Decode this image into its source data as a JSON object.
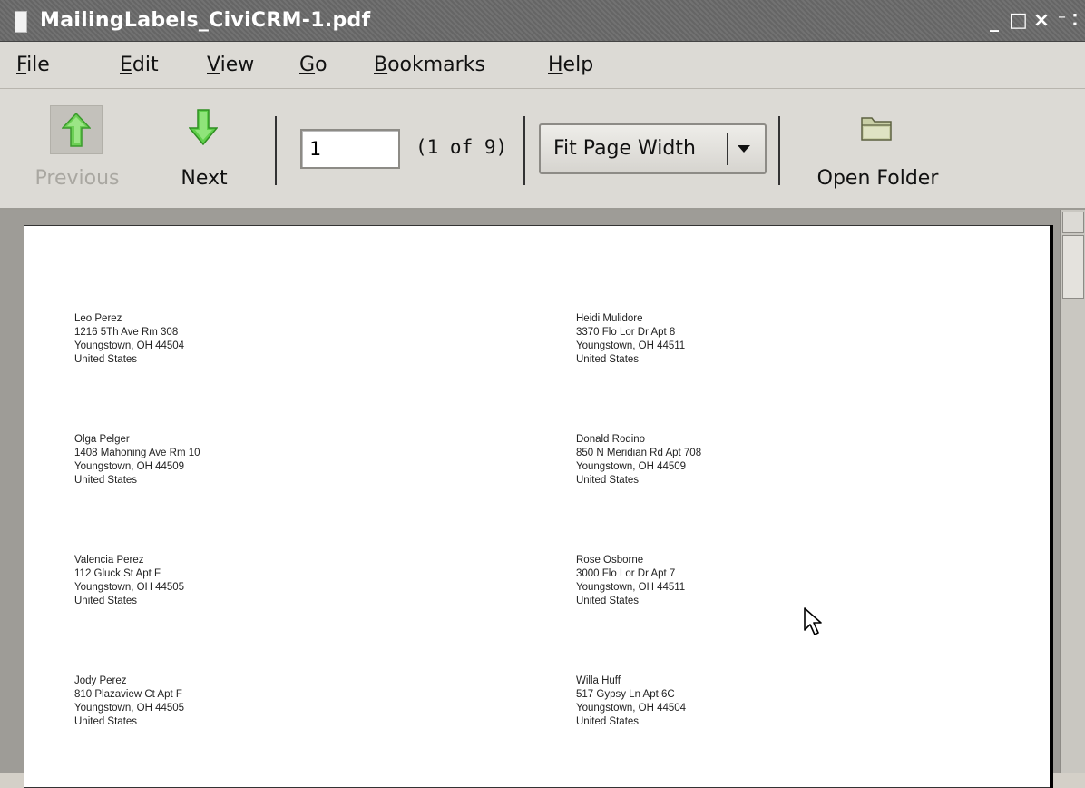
{
  "window": {
    "title": "MailingLabels_CiviCRM-1.pdf",
    "controls": {
      "minimize": "_",
      "maximize": "□",
      "close": "×",
      "extra": "⁻ ⁚"
    }
  },
  "menu": [
    {
      "label": "File",
      "mnemonic": "F",
      "rest": "ile"
    },
    {
      "label": "Edit",
      "mnemonic": "E",
      "rest": "dit"
    },
    {
      "label": "View",
      "mnemonic": "V",
      "rest": "iew"
    },
    {
      "label": "Go",
      "mnemonic": "G",
      "rest": "o"
    },
    {
      "label": "Bookmarks",
      "mnemonic": "B",
      "rest": "ookmarks"
    },
    {
      "label": "Help",
      "mnemonic": "H",
      "rest": "elp"
    }
  ],
  "toolbar": {
    "previous_label": "Previous",
    "previous_enabled": false,
    "next_label": "Next",
    "page_value": "1",
    "page_count": "(1 of 9)",
    "zoom_value": "Fit Page Width",
    "open_folder_label": "Open Folder",
    "icons": {
      "previous": "up-arrow-icon",
      "next": "down-arrow-icon",
      "zoom_dropdown": "dropdown-arrow-icon",
      "open_folder": "folder-icon"
    },
    "colors": {
      "arrow_green": "#5fcf4a",
      "arrow_green_dark": "#2f8f22",
      "disabled_text": "#a9a7a1"
    }
  },
  "labels": {
    "left": [
      [
        "Leo Perez",
        "1216 5Th Ave Rm 308",
        "Youngstown, OH 44504",
        "United States"
      ],
      [
        "Olga Pelger",
        "1408 Mahoning Ave Rm 10",
        "Youngstown, OH 44509",
        "United States"
      ],
      [
        "Valencia Perez",
        "112 Gluck St Apt F",
        "Youngstown, OH 44505",
        "United States"
      ],
      [
        "Jody Perez",
        "810 Plazaview Ct Apt F",
        "Youngstown, OH 44505",
        "United States"
      ]
    ],
    "right": [
      [
        "Heidi Mulidore",
        "3370 Flo Lor Dr Apt 8",
        "Youngstown, OH 44511",
        "United States"
      ],
      [
        "Donald Rodino",
        "850 N Meridian Rd Apt 708",
        "Youngstown, OH 44509",
        "United States"
      ],
      [
        "Rose Osborne",
        "3000 Flo Lor Dr Apt 7",
        "Youngstown, OH 44511",
        "United States"
      ],
      [
        "Willa Huff",
        "517 Gypsy Ln Apt 6C",
        "Youngstown, OH 44504",
        "United States"
      ]
    ]
  }
}
